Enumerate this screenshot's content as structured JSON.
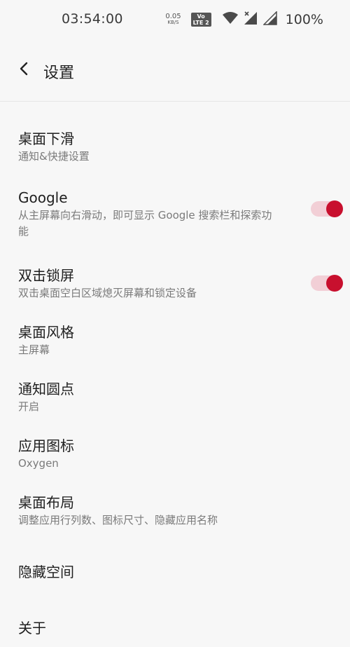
{
  "status_bar": {
    "time": "03:54:00",
    "net_speed_value": "0.05",
    "net_speed_unit": "KB/S",
    "volte_top": "Vo",
    "volte_bottom": "LTE 2",
    "battery": "100%"
  },
  "header": {
    "title": "设置"
  },
  "items": [
    {
      "title": "桌面下滑",
      "subtitle": "通知&快捷设置"
    },
    {
      "title": "Google",
      "subtitle": "从主屏幕向右滑动，即可显示 Google 搜索栏和探索功能",
      "toggle": true
    },
    {
      "title": "双击锁屏",
      "subtitle": "双击桌面空白区域熄灭屏幕和锁定设备",
      "toggle": true
    },
    {
      "title": "桌面风格",
      "subtitle": "主屏幕"
    },
    {
      "title": "通知圆点",
      "subtitle": "开启"
    },
    {
      "title": "应用图标",
      "subtitle": "Oxygen"
    },
    {
      "title": "桌面布局",
      "subtitle": "调整应用行列数、图标尺寸、隐藏应用名称"
    },
    {
      "title": "隐藏空间",
      "subtitle": ""
    },
    {
      "title": "关于",
      "subtitle": ""
    }
  ],
  "colors": {
    "accent": "#c8102e",
    "toggle_track": "#f2cfd6",
    "background": "#f7f7f7"
  },
  "icons": {
    "back": "chevron-left-icon",
    "wifi": "wifi-icon",
    "signal": "cell-signal-icon"
  }
}
